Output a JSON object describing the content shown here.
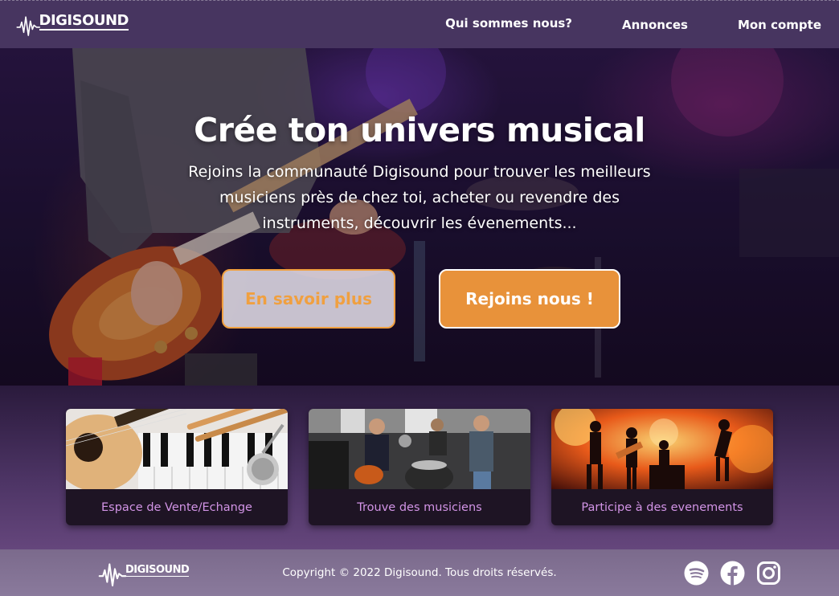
{
  "header": {
    "logo_text": "DIGISOUND",
    "nav": [
      {
        "label": "Qui sommes nous?"
      },
      {
        "label": "Annonces"
      },
      {
        "label": "Mon compte"
      }
    ]
  },
  "hero": {
    "title": "Crée ton univers musical",
    "subtitle": "Rejoins la communauté Digisound pour trouver les meilleurs musiciens près de chez toi, acheter ou revendre des instruments, découvrir les évenements...",
    "btn_more": "En savoir plus",
    "btn_join": "Rejoins nous !"
  },
  "cards": [
    {
      "label": "Espace de Vente/Echange",
      "image": "instruments-photo"
    },
    {
      "label": "Trouve des musiciens",
      "image": "musicians-photo"
    },
    {
      "label": "Participe à des evenements",
      "image": "concert-photo"
    }
  ],
  "footer": {
    "logo_text": "DIGISOUND",
    "copyright": "Copyright © 2022 Digisound. Tous droits réservés.",
    "socials": [
      "spotify-icon",
      "facebook-icon",
      "instagram-icon"
    ]
  },
  "colors": {
    "accent_orange": "#e8923a",
    "card_label": "#d294e6",
    "header_bg": "#523e6e",
    "footer_bg": "#8a7a9c"
  }
}
